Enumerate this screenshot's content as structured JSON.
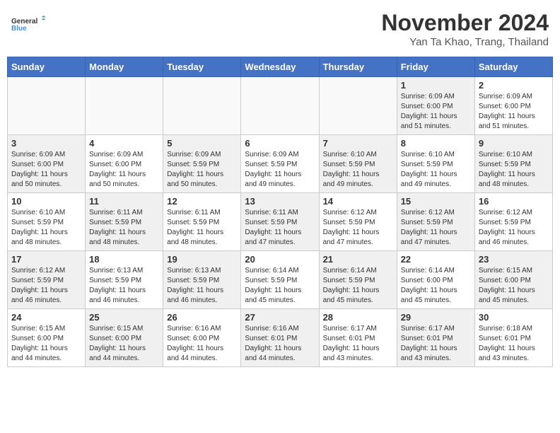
{
  "header": {
    "logo_line1": "General",
    "logo_line2": "Blue",
    "month": "November 2024",
    "location": "Yan Ta Khao, Trang, Thailand"
  },
  "days_of_week": [
    "Sunday",
    "Monday",
    "Tuesday",
    "Wednesday",
    "Thursday",
    "Friday",
    "Saturday"
  ],
  "weeks": [
    [
      {
        "day": "",
        "info": "",
        "empty": true
      },
      {
        "day": "",
        "info": "",
        "empty": true
      },
      {
        "day": "",
        "info": "",
        "empty": true
      },
      {
        "day": "",
        "info": "",
        "empty": true
      },
      {
        "day": "",
        "info": "",
        "empty": true
      },
      {
        "day": "1",
        "info": "Sunrise: 6:09 AM\nSunset: 6:00 PM\nDaylight: 11 hours\nand 51 minutes.",
        "shaded": true
      },
      {
        "day": "2",
        "info": "Sunrise: 6:09 AM\nSunset: 6:00 PM\nDaylight: 11 hours\nand 51 minutes.",
        "shaded": false
      }
    ],
    [
      {
        "day": "3",
        "info": "Sunrise: 6:09 AM\nSunset: 6:00 PM\nDaylight: 11 hours\nand 50 minutes.",
        "shaded": true
      },
      {
        "day": "4",
        "info": "Sunrise: 6:09 AM\nSunset: 6:00 PM\nDaylight: 11 hours\nand 50 minutes.",
        "shaded": false
      },
      {
        "day": "5",
        "info": "Sunrise: 6:09 AM\nSunset: 5:59 PM\nDaylight: 11 hours\nand 50 minutes.",
        "shaded": true
      },
      {
        "day": "6",
        "info": "Sunrise: 6:09 AM\nSunset: 5:59 PM\nDaylight: 11 hours\nand 49 minutes.",
        "shaded": false
      },
      {
        "day": "7",
        "info": "Sunrise: 6:10 AM\nSunset: 5:59 PM\nDaylight: 11 hours\nand 49 minutes.",
        "shaded": true
      },
      {
        "day": "8",
        "info": "Sunrise: 6:10 AM\nSunset: 5:59 PM\nDaylight: 11 hours\nand 49 minutes.",
        "shaded": false
      },
      {
        "day": "9",
        "info": "Sunrise: 6:10 AM\nSunset: 5:59 PM\nDaylight: 11 hours\nand 48 minutes.",
        "shaded": true
      }
    ],
    [
      {
        "day": "10",
        "info": "Sunrise: 6:10 AM\nSunset: 5:59 PM\nDaylight: 11 hours\nand 48 minutes.",
        "shaded": false
      },
      {
        "day": "11",
        "info": "Sunrise: 6:11 AM\nSunset: 5:59 PM\nDaylight: 11 hours\nand 48 minutes.",
        "shaded": true
      },
      {
        "day": "12",
        "info": "Sunrise: 6:11 AM\nSunset: 5:59 PM\nDaylight: 11 hours\nand 48 minutes.",
        "shaded": false
      },
      {
        "day": "13",
        "info": "Sunrise: 6:11 AM\nSunset: 5:59 PM\nDaylight: 11 hours\nand 47 minutes.",
        "shaded": true
      },
      {
        "day": "14",
        "info": "Sunrise: 6:12 AM\nSunset: 5:59 PM\nDaylight: 11 hours\nand 47 minutes.",
        "shaded": false
      },
      {
        "day": "15",
        "info": "Sunrise: 6:12 AM\nSunset: 5:59 PM\nDaylight: 11 hours\nand 47 minutes.",
        "shaded": true
      },
      {
        "day": "16",
        "info": "Sunrise: 6:12 AM\nSunset: 5:59 PM\nDaylight: 11 hours\nand 46 minutes.",
        "shaded": false
      }
    ],
    [
      {
        "day": "17",
        "info": "Sunrise: 6:12 AM\nSunset: 5:59 PM\nDaylight: 11 hours\nand 46 minutes.",
        "shaded": true
      },
      {
        "day": "18",
        "info": "Sunrise: 6:13 AM\nSunset: 5:59 PM\nDaylight: 11 hours\nand 46 minutes.",
        "shaded": false
      },
      {
        "day": "19",
        "info": "Sunrise: 6:13 AM\nSunset: 5:59 PM\nDaylight: 11 hours\nand 46 minutes.",
        "shaded": true
      },
      {
        "day": "20",
        "info": "Sunrise: 6:14 AM\nSunset: 5:59 PM\nDaylight: 11 hours\nand 45 minutes.",
        "shaded": false
      },
      {
        "day": "21",
        "info": "Sunrise: 6:14 AM\nSunset: 5:59 PM\nDaylight: 11 hours\nand 45 minutes.",
        "shaded": true
      },
      {
        "day": "22",
        "info": "Sunrise: 6:14 AM\nSunset: 6:00 PM\nDaylight: 11 hours\nand 45 minutes.",
        "shaded": false
      },
      {
        "day": "23",
        "info": "Sunrise: 6:15 AM\nSunset: 6:00 PM\nDaylight: 11 hours\nand 45 minutes.",
        "shaded": true
      }
    ],
    [
      {
        "day": "24",
        "info": "Sunrise: 6:15 AM\nSunset: 6:00 PM\nDaylight: 11 hours\nand 44 minutes.",
        "shaded": false
      },
      {
        "day": "25",
        "info": "Sunrise: 6:15 AM\nSunset: 6:00 PM\nDaylight: 11 hours\nand 44 minutes.",
        "shaded": true
      },
      {
        "day": "26",
        "info": "Sunrise: 6:16 AM\nSunset: 6:00 PM\nDaylight: 11 hours\nand 44 minutes.",
        "shaded": false
      },
      {
        "day": "27",
        "info": "Sunrise: 6:16 AM\nSunset: 6:01 PM\nDaylight: 11 hours\nand 44 minutes.",
        "shaded": true
      },
      {
        "day": "28",
        "info": "Sunrise: 6:17 AM\nSunset: 6:01 PM\nDaylight: 11 hours\nand 43 minutes.",
        "shaded": false
      },
      {
        "day": "29",
        "info": "Sunrise: 6:17 AM\nSunset: 6:01 PM\nDaylight: 11 hours\nand 43 minutes.",
        "shaded": true
      },
      {
        "day": "30",
        "info": "Sunrise: 6:18 AM\nSunset: 6:01 PM\nDaylight: 11 hours\nand 43 minutes.",
        "shaded": false
      }
    ]
  ]
}
